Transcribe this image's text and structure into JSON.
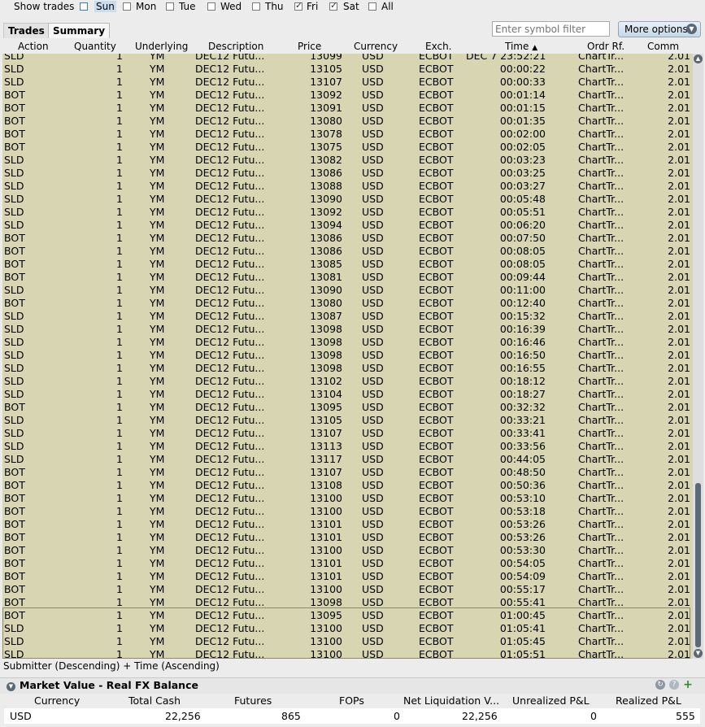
{
  "day_filter": {
    "label": "Show trades",
    "days": [
      {
        "label": "Sun",
        "checked": false
      },
      {
        "label": "Mon",
        "checked": false
      },
      {
        "label": "Tue",
        "checked": false
      },
      {
        "label": "Wed",
        "checked": false
      },
      {
        "label": "Thu",
        "checked": false
      },
      {
        "label": "Fri",
        "checked": true
      },
      {
        "label": "Sat",
        "checked": true
      },
      {
        "label": "All",
        "checked": false
      }
    ]
  },
  "tabs": {
    "trades": "Trades",
    "summary": "Summary"
  },
  "toolbar": {
    "symbol_placeholder": "Enter symbol filter",
    "more_options": "More options"
  },
  "columns": {
    "action": "Action",
    "quantity": "Quantity",
    "underlying": "Underlying",
    "description": "Description",
    "price": "Price",
    "currency": "Currency",
    "exch": "Exch.",
    "time": "Time",
    "ordr": "Ordr Rf.",
    "comm": "Comm"
  },
  "trade_defaults": {
    "quantity": "1",
    "underlying": "YM",
    "description": "DEC12 Futu...",
    "currency": "USD",
    "exch": "ECBOT",
    "ordr": "ChartTr...",
    "comm": "2.01"
  },
  "trades": [
    [
      "SLD",
      "13099",
      "DEC 7 23:52:21"
    ],
    [
      "SLD",
      "13105",
      "00:00:22"
    ],
    [
      "SLD",
      "13107",
      "00:00:33"
    ],
    [
      "BOT",
      "13092",
      "00:01:14"
    ],
    [
      "BOT",
      "13091",
      "00:01:15"
    ],
    [
      "BOT",
      "13080",
      "00:01:35"
    ],
    [
      "BOT",
      "13078",
      "00:02:00"
    ],
    [
      "BOT",
      "13075",
      "00:02:05"
    ],
    [
      "SLD",
      "13082",
      "00:03:23"
    ],
    [
      "SLD",
      "13086",
      "00:03:25"
    ],
    [
      "SLD",
      "13088",
      "00:03:27"
    ],
    [
      "SLD",
      "13090",
      "00:05:48"
    ],
    [
      "SLD",
      "13092",
      "00:05:51"
    ],
    [
      "SLD",
      "13094",
      "00:06:20"
    ],
    [
      "BOT",
      "13086",
      "00:07:50"
    ],
    [
      "BOT",
      "13086",
      "00:08:05"
    ],
    [
      "BOT",
      "13085",
      "00:08:05"
    ],
    [
      "BOT",
      "13081",
      "00:09:44"
    ],
    [
      "SLD",
      "13090",
      "00:11:00"
    ],
    [
      "BOT",
      "13080",
      "00:12:40"
    ],
    [
      "SLD",
      "13087",
      "00:15:32"
    ],
    [
      "SLD",
      "13098",
      "00:16:39"
    ],
    [
      "SLD",
      "13098",
      "00:16:46"
    ],
    [
      "SLD",
      "13098",
      "00:16:50"
    ],
    [
      "SLD",
      "13098",
      "00:16:55"
    ],
    [
      "SLD",
      "13102",
      "00:18:12"
    ],
    [
      "SLD",
      "13104",
      "00:18:27"
    ],
    [
      "BOT",
      "13095",
      "00:32:32"
    ],
    [
      "SLD",
      "13105",
      "00:33:21"
    ],
    [
      "SLD",
      "13107",
      "00:33:41"
    ],
    [
      "SLD",
      "13113",
      "00:33:56"
    ],
    [
      "SLD",
      "13117",
      "00:44:05"
    ],
    [
      "BOT",
      "13107",
      "00:48:50"
    ],
    [
      "BOT",
      "13108",
      "00:50:36"
    ],
    [
      "BOT",
      "13100",
      "00:53:10"
    ],
    [
      "BOT",
      "13100",
      "00:53:18"
    ],
    [
      "BOT",
      "13101",
      "00:53:26"
    ],
    [
      "BOT",
      "13101",
      "00:53:26"
    ],
    [
      "BOT",
      "13100",
      "00:53:30"
    ],
    [
      "BOT",
      "13101",
      "00:54:05"
    ],
    [
      "BOT",
      "13101",
      "00:54:09"
    ],
    [
      "BOT",
      "13100",
      "00:55:17"
    ],
    [
      "BOT",
      "13098",
      "00:55:41"
    ],
    [
      "BOT",
      "13095",
      "01:00:45"
    ],
    [
      "SLD",
      "13100",
      "01:05:41"
    ],
    [
      "SLD",
      "13100",
      "01:05:45"
    ],
    [
      "SLD",
      "13100",
      "01:05:51"
    ]
  ],
  "sort_description": "Submitter (Descending)  +  Time (Ascending)",
  "market_value": {
    "title": "Market Value - Real FX Balance",
    "columns": {
      "currency": "Currency",
      "total_cash": "Total Cash",
      "futures": "Futures",
      "fops": "FOPs",
      "net_liq": "Net Liquidation V...",
      "unrealized": "Unrealized P&L",
      "realized": "Realized P&L"
    },
    "row": {
      "currency": "USD",
      "total_cash": "22,256",
      "futures": "865",
      "fops": "0",
      "net_liq": "22,256",
      "unrealized": "0",
      "realized": "555"
    }
  },
  "colors": {
    "table_bg": "#d8d5b2",
    "accent": "#5a6875"
  }
}
